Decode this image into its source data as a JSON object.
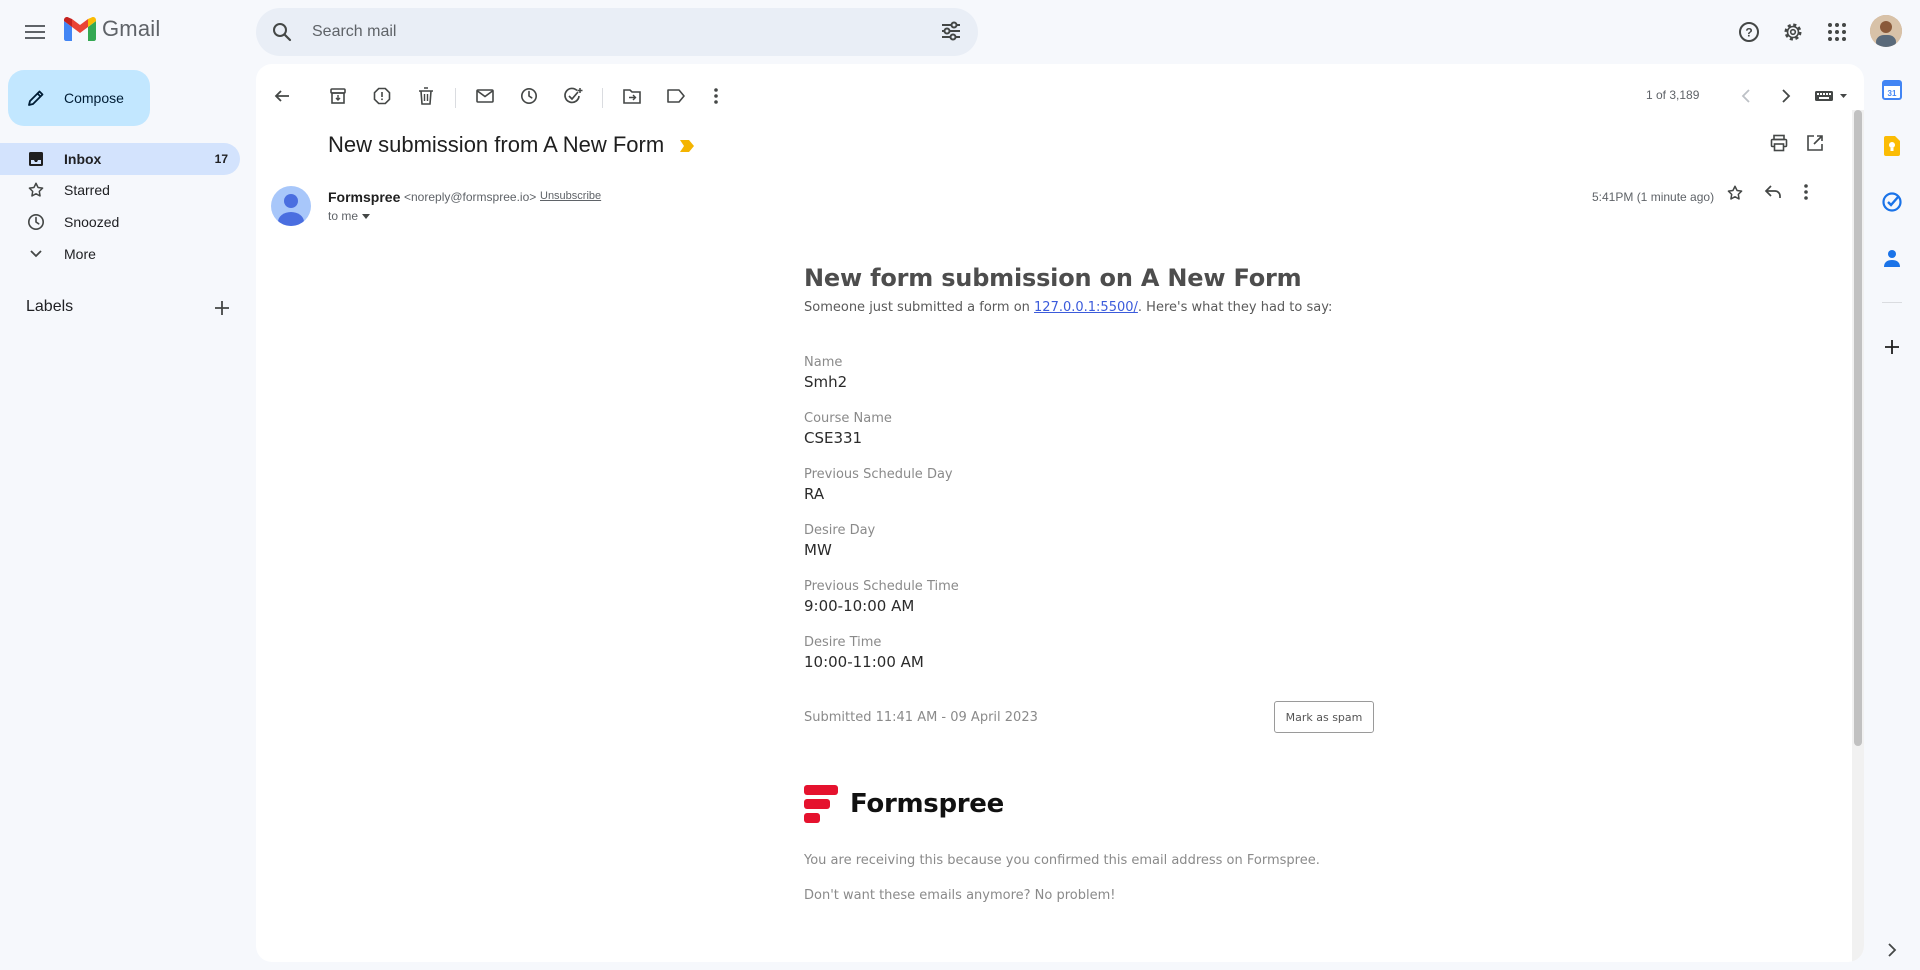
{
  "app": {
    "name": "Gmail"
  },
  "search": {
    "placeholder": "Search mail"
  },
  "compose": {
    "label": "Compose"
  },
  "nav": {
    "items": [
      {
        "label": "Inbox",
        "count": "17",
        "icon": "inbox-icon"
      },
      {
        "label": "Starred",
        "count": "",
        "icon": "star-icon"
      },
      {
        "label": "Snoozed",
        "count": "",
        "icon": "clock-icon"
      },
      {
        "label": "More",
        "count": "",
        "icon": "chevron-down-icon"
      }
    ],
    "labels_heading": "Labels"
  },
  "toolbar": {
    "pager": "1 of 3,189"
  },
  "message": {
    "subject": "New submission from A New Form",
    "sender_name": "Formspree",
    "sender_email": "<noreply@formspree.io>",
    "unsubscribe": "Unsubscribe",
    "to": "to me",
    "time": "5:41PM (1 minute ago)"
  },
  "email_body": {
    "heading": "New form submission on A New Form",
    "intro_before": "Someone just submitted a form on ",
    "intro_link": "127.0.0.1:5500/",
    "intro_after": ". Here's what they had to say:",
    "fields": [
      {
        "label": "Name",
        "value": "Smh2"
      },
      {
        "label": "Course Name",
        "value": "CSE331"
      },
      {
        "label": "Previous Schedule Day",
        "value": "RA"
      },
      {
        "label": "Desire Day",
        "value": "MW"
      },
      {
        "label": "Previous Schedule Time",
        "value": "9:00-10:00 AM"
      },
      {
        "label": "Desire Time",
        "value": "10:00-11:00 AM"
      }
    ],
    "submitted": "Submitted 11:41 AM - 09 April 2023",
    "spam_button": "Mark as spam",
    "brand": "Formspree",
    "footer_1": "You are receiving this because you confirmed this email address on Formspree.",
    "footer_2": "Don't want these emails anymore? No problem!"
  },
  "colors": {
    "background": "#f6f8fc",
    "compose": "#c2e7ff",
    "inbox_active": "#d3e3fd",
    "important": "#f4b400",
    "formspree_red": "#e5122e",
    "link": "#3b5bdb"
  }
}
